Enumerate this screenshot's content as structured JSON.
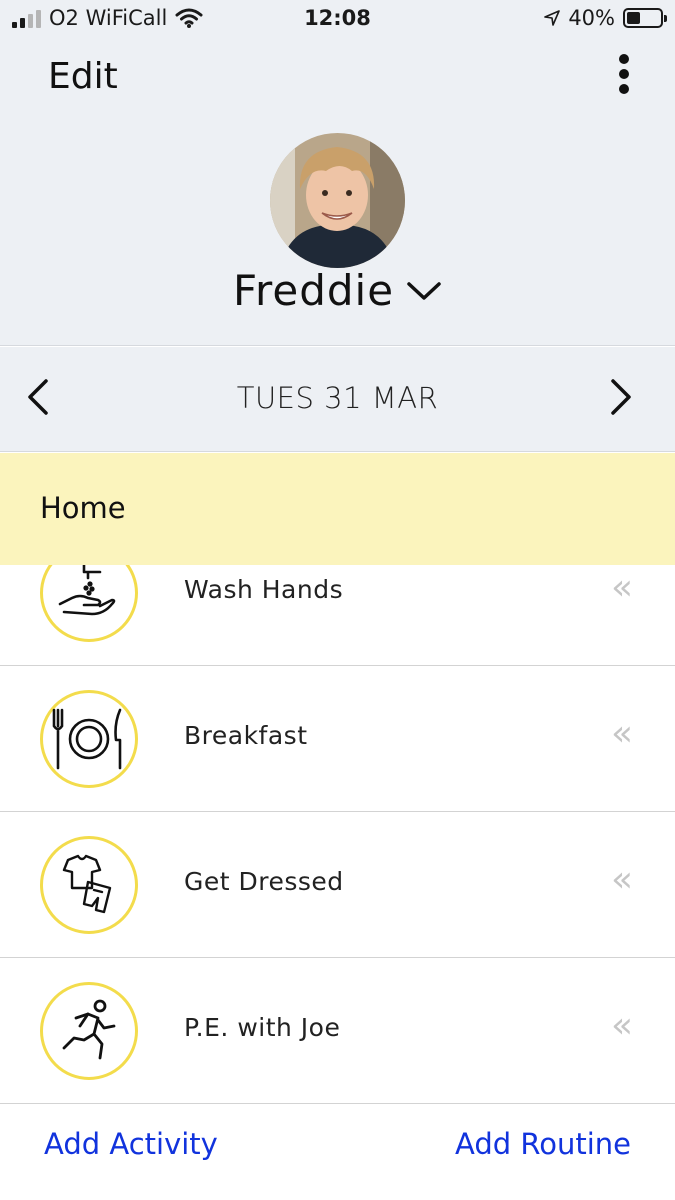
{
  "status": {
    "carrier": "O2 WiFiCall",
    "time": "12:08",
    "battery_text": "40%",
    "battery_level": 0.4
  },
  "header": {
    "edit_label": "Edit",
    "child_name": "Freddie"
  },
  "date": {
    "label": "TUES 31 MAR"
  },
  "section": {
    "title": "Home"
  },
  "activities": [
    {
      "label": "Wash Hands",
      "icon": "wash-hands-icon"
    },
    {
      "label": "Breakfast",
      "icon": "plate-cutlery-icon"
    },
    {
      "label": "Get Dressed",
      "icon": "clothes-icon"
    },
    {
      "label": "P.E. with Joe",
      "icon": "running-person-icon"
    }
  ],
  "row_action_glyph": "«",
  "footer": {
    "add_activity_label": "Add Activity",
    "add_routine_label": "Add Routine"
  },
  "colors": {
    "header_bg": "#edf0f4",
    "section_bg": "#fbf4bd",
    "icon_ring": "#f3dc4c",
    "link": "#1133dd"
  }
}
